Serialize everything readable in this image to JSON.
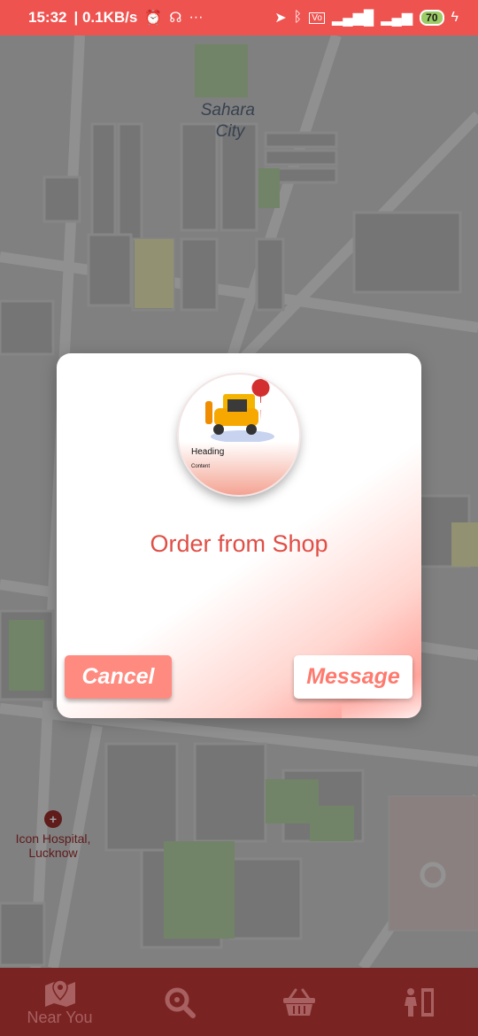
{
  "status_bar": {
    "time": "15:32",
    "speed": "| 0.1KB/s",
    "battery": "70",
    "icons": [
      "alarm-icon",
      "headset-icon",
      "more-icon",
      "location-icon",
      "bluetooth-icon",
      "volte-icon",
      "signal-icon",
      "charging-icon"
    ]
  },
  "map": {
    "labels": {
      "area": "Sahara\nCity",
      "hospital_line1": "Icon Hospital,",
      "hospital_line2": "Lucknow"
    }
  },
  "dialog": {
    "image_heading": "Heading",
    "image_content": "Content",
    "title": "Order from Shop",
    "cancel_label": "Cancel",
    "message_label": "Message"
  },
  "bottom_nav": {
    "items": [
      {
        "icon": "map-pin-icon",
        "label": "Near You"
      },
      {
        "icon": "search-icon",
        "label": ""
      },
      {
        "icon": "basket-icon",
        "label": ""
      },
      {
        "icon": "person-door-icon",
        "label": ""
      }
    ]
  },
  "colors": {
    "status_bar": "#ef5350",
    "accent": "#ff8a80",
    "title": "#e04e46",
    "nav_bg": "#7a2323"
  }
}
